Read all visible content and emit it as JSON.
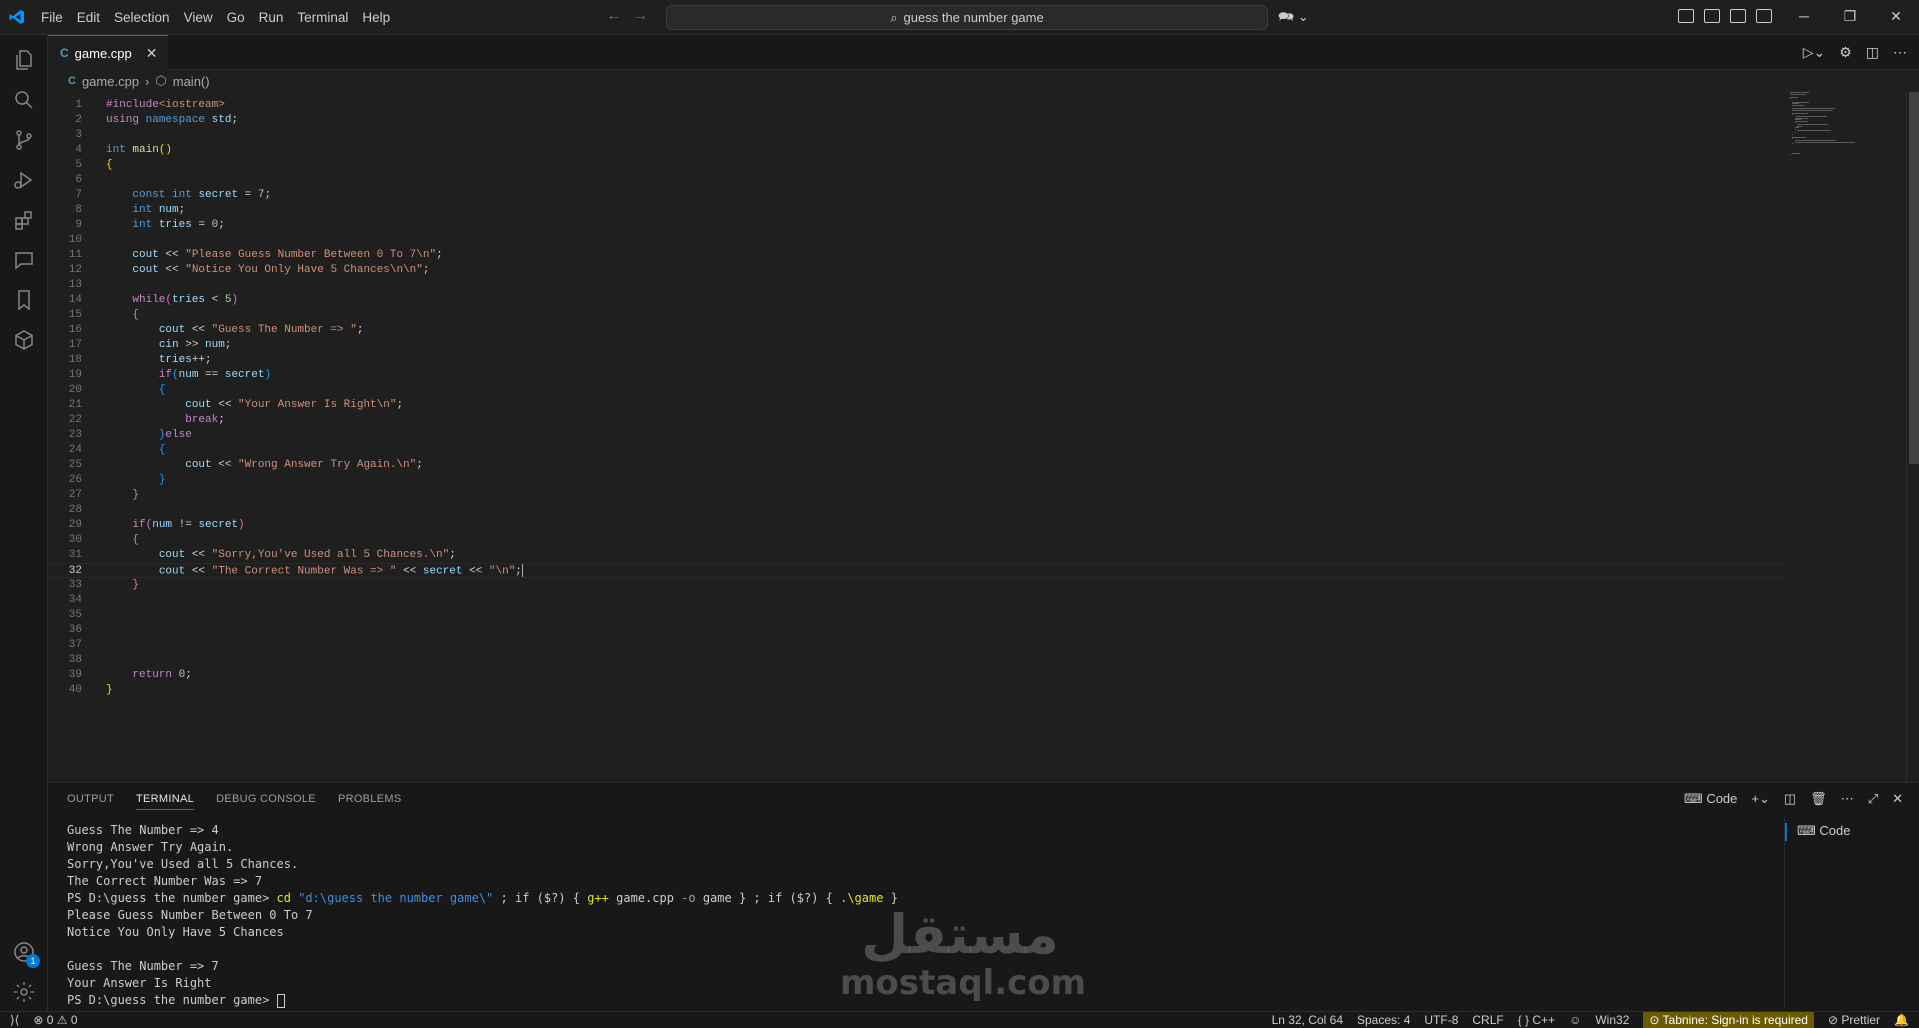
{
  "titlebar": {
    "menu": [
      "File",
      "Edit",
      "Selection",
      "View",
      "Go",
      "Run",
      "Terminal",
      "Help"
    ],
    "search_text": "guess the number game"
  },
  "tab": {
    "filename": "game.cpp",
    "lang_icon": "C"
  },
  "breadcrumb": {
    "file": "game.cpp",
    "symbol": "main()"
  },
  "code_lines": [
    {
      "n": "1",
      "html": "<span class='inc'>#include</span><span class='incs'>&lt;iostream&gt;</span>"
    },
    {
      "n": "2",
      "html": "<span class='ctl'>using</span> <span class='kw'>namespace</span> <span class='id'>std</span>;"
    },
    {
      "n": "3",
      "html": ""
    },
    {
      "n": "4",
      "html": "<span class='kw'>int</span> <span class='fn'>main</span><span class='b1'>()</span>"
    },
    {
      "n": "5",
      "html": "<span class='b1'>{</span>"
    },
    {
      "n": "6",
      "html": ""
    },
    {
      "n": "7",
      "html": "    <span class='kw'>const</span> <span class='kw'>int</span> <span class='id'>secret</span> = <span class='num'>7</span>;"
    },
    {
      "n": "8",
      "html": "    <span class='kw'>int</span> <span class='id'>num</span>;"
    },
    {
      "n": "9",
      "html": "    <span class='kw'>int</span> <span class='id'>tries</span> = <span class='num'>0</span>;"
    },
    {
      "n": "10",
      "html": ""
    },
    {
      "n": "11",
      "html": "    <span class='id'>cout</span> &lt;&lt; <span class='str'>\"Please Guess Number Between 0 To 7\\n\"</span>;"
    },
    {
      "n": "12",
      "html": "    <span class='id'>cout</span> &lt;&lt; <span class='str'>\"Notice You Only Have 5 Chances\\n\\n\"</span>;"
    },
    {
      "n": "13",
      "html": ""
    },
    {
      "n": "14",
      "html": "    <span class='ctl'>while</span><span class='b2'>(</span><span class='id'>tries</span> &lt; <span class='num'>5</span><span class='b2'>)</span>"
    },
    {
      "n": "15",
      "html": "    <span class='b2'>{</span>"
    },
    {
      "n": "16",
      "html": "        <span class='id'>cout</span> &lt;&lt; <span class='str'>\"Guess The Number =&gt; \"</span>;"
    },
    {
      "n": "17",
      "html": "        <span class='id'>cin</span> &gt;&gt; <span class='id'>num</span>;"
    },
    {
      "n": "18",
      "html": "        <span class='id'>tries</span>++;"
    },
    {
      "n": "19",
      "html": "        <span class='ctl'>if</span><span class='b3'>(</span><span class='id'>num</span> == <span class='id'>secret</span><span class='b3'>)</span>"
    },
    {
      "n": "20",
      "html": "        <span class='b3'>{</span>"
    },
    {
      "n": "21",
      "html": "            <span class='id'>cout</span> &lt;&lt; <span class='str'>\"Your Answer Is Right\\n\"</span>;"
    },
    {
      "n": "22",
      "html": "            <span class='ctl'>break</span>;"
    },
    {
      "n": "23",
      "html": "        <span class='b3'>}</span><span class='ctl'>else</span>"
    },
    {
      "n": "24",
      "html": "        <span class='b3'>{</span>"
    },
    {
      "n": "25",
      "html": "            <span class='id'>cout</span> &lt;&lt; <span class='str'>\"Wrong Answer Try Again.\\n\"</span>;"
    },
    {
      "n": "26",
      "html": "        <span class='b3'>}</span>"
    },
    {
      "n": "27",
      "html": "    <span class='b2'>}</span>"
    },
    {
      "n": "28",
      "html": ""
    },
    {
      "n": "29",
      "html": "    <span class='ctl'>if</span><span class='b2'>(</span><span class='id'>num</span> != <span class='id'>secret</span><span class='b2'>)</span>"
    },
    {
      "n": "30",
      "html": "    <span class='b2'>{</span>"
    },
    {
      "n": "31",
      "html": "        <span class='id'>cout</span> &lt;&lt; <span class='str'>\"Sorry,You've Used all 5 Chances.\\n\"</span>;"
    },
    {
      "n": "32",
      "html": "        <span class='id'>cout</span> &lt;&lt; <span class='str'>\"The Correct Number Was =&gt; \"</span> &lt;&lt; <span class='id'>secret</span> &lt;&lt; <span class='str'>\"\\n\"</span>;<span class='cursor'></span>"
    },
    {
      "n": "33",
      "html": "    <span class='b2'>}</span>"
    },
    {
      "n": "34",
      "html": ""
    },
    {
      "n": "35",
      "html": ""
    },
    {
      "n": "36",
      "html": ""
    },
    {
      "n": "37",
      "html": ""
    },
    {
      "n": "38",
      "html": ""
    },
    {
      "n": "39",
      "html": "    <span class='ctl'>return</span> <span class='num'>0</span>;"
    },
    {
      "n": "40",
      "html": "<span class='b1'>}</span>"
    }
  ],
  "current_line": "32",
  "panel": {
    "tabs": [
      "OUTPUT",
      "TERMINAL",
      "DEBUG CONSOLE",
      "PROBLEMS"
    ],
    "active_tab": "TERMINAL",
    "terminal_name": "Code",
    "terminal_list_item": "Code"
  },
  "terminal_lines": [
    "Guess The Number => 4",
    "Wrong Answer Try Again.",
    "Sorry,You've Used all 5 Chances.",
    "The Correct Number Was => 7",
    "__CMD__",
    "Please Guess Number Between 0 To 7",
    "Notice You Only Have 5 Chances",
    "",
    "Guess The Number => 7",
    "Your Answer Is Right",
    "__PROMPT__"
  ],
  "terminal_cmd": {
    "prompt": "PS D:\\guess the number game> ",
    "cd": "cd",
    "path": "\"d:\\guess the number game\\\"",
    "sep1": " ; ",
    "if1": "if",
    "cond1": " ($?) { ",
    "gpp": "g++",
    "args1": " game.cpp ",
    "flag": "-o",
    "args2": " game } ; ",
    "if2": "if",
    "cond2": " ($?) { ",
    "run": ".\\game",
    "end": " }"
  },
  "terminal_prompt_end": "PS D:\\guess the number game> ",
  "watermark": {
    "arabic": "مستقل",
    "latin": "mostaql.com"
  },
  "statusbar": {
    "errors": "0",
    "warnings": "0",
    "position": "Ln 32, Col 64",
    "spaces": "Spaces: 4",
    "encoding": "UTF-8",
    "eol": "CRLF",
    "language": "C++",
    "platform": "Win32",
    "tabnine": "Tabnine: Sign-in is required",
    "prettier": "Prettier"
  }
}
